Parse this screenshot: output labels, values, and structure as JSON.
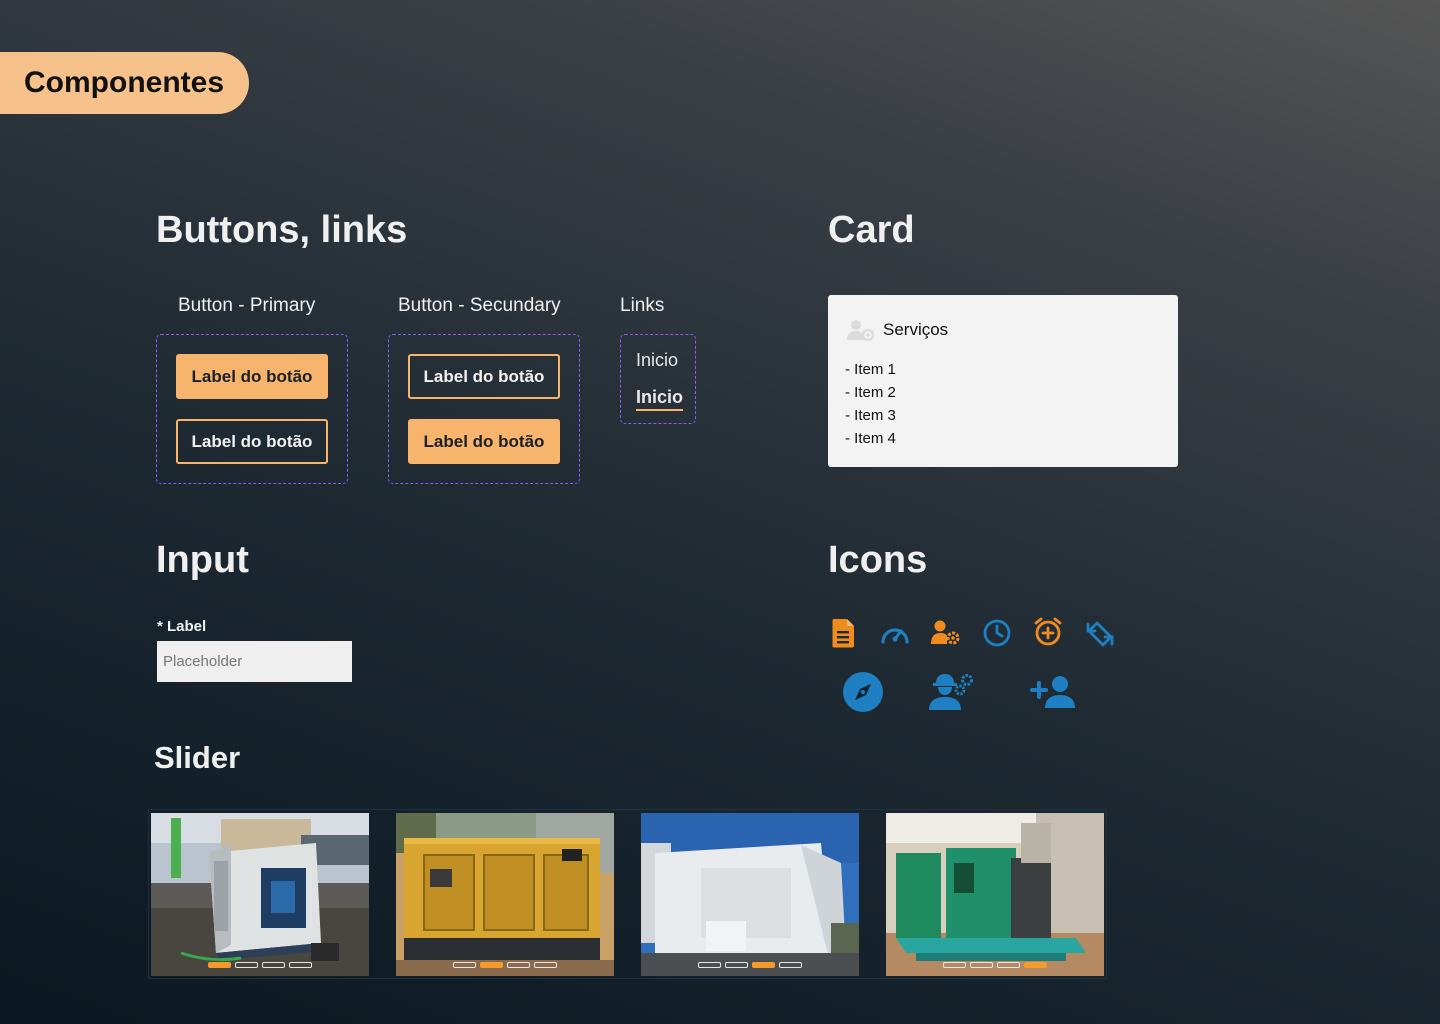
{
  "page": {
    "tag": "Componentes"
  },
  "sections": {
    "buttons_links": "Buttons, links",
    "card": "Card",
    "input": "Input",
    "icons": "Icons",
    "slider": "Slider"
  },
  "buttons": {
    "primary_title": "Button - Primary",
    "secondary_title": "Button - Secundary",
    "label": "Label do botão"
  },
  "links": {
    "title": "Links",
    "normal": "Inicio",
    "active": "Inicio"
  },
  "card": {
    "title": "Serviços",
    "icon": "users-gear-icon",
    "items": [
      "- Item 1",
      "- Item 2",
      "- Item 3",
      "- Item 4"
    ]
  },
  "input": {
    "label": "* Label",
    "placeholder": "Placeholder"
  },
  "icons": {
    "row1": [
      "file-icon",
      "speedometer-icon",
      "user-gear-icon",
      "clock-icon",
      "alarm-add-icon",
      "sync-icon"
    ],
    "row2": [
      "compass-icon",
      "worker-gears-icon",
      "add-user-icon"
    ],
    "colors": {
      "orange": "#f08c1e",
      "blue": "#1e7fc2"
    }
  },
  "slider": {
    "slides": [
      {
        "name": "generator-photo-1",
        "active_dot": 0
      },
      {
        "name": "generator-photo-2",
        "active_dot": 1
      },
      {
        "name": "generator-photo-3",
        "active_dot": 2
      },
      {
        "name": "generator-photo-4",
        "active_dot": 3
      }
    ],
    "dot_count": 4
  },
  "colors": {
    "accent": "#f6b46d",
    "dashed_border": "#8a5cf6",
    "card_bg": "#f3f3f3"
  }
}
